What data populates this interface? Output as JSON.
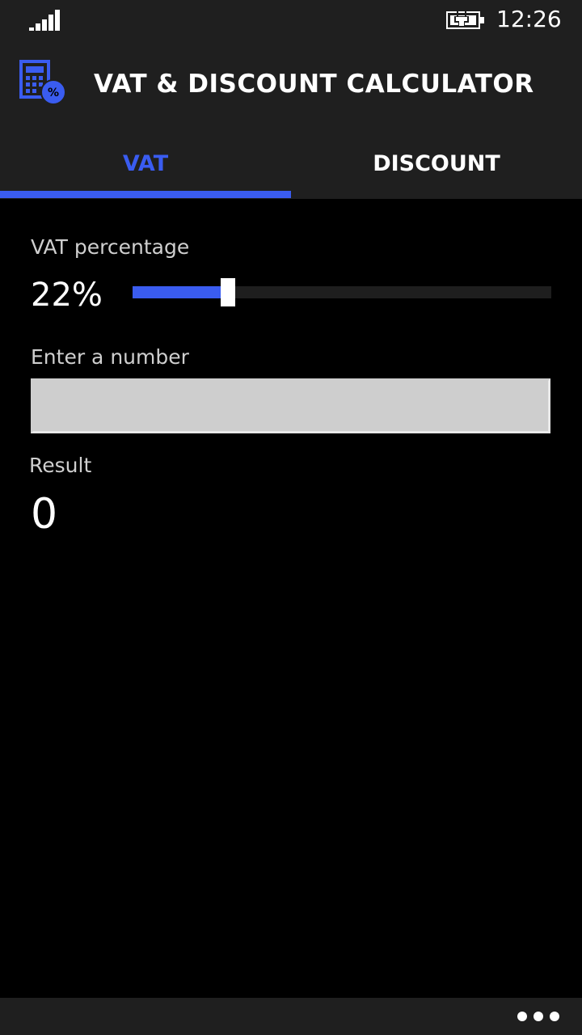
{
  "status_bar": {
    "time": "12:26",
    "signal_icon": "signal-strength-icon",
    "battery_icon": "battery-charging-icon"
  },
  "header": {
    "title": "VAT & DISCOUNT CALCULATOR",
    "app_icon": "calculator-percent-icon"
  },
  "tabs": [
    {
      "label": "VAT",
      "active": true
    },
    {
      "label": "DISCOUNT",
      "active": false
    }
  ],
  "vat": {
    "label": "VAT percentage",
    "value_text": "22%",
    "slider_value": 22,
    "slider_fill_fraction": 0.22
  },
  "input": {
    "label": "Enter a number",
    "value": "",
    "placeholder": ""
  },
  "result": {
    "label": "Result",
    "value": "0"
  },
  "app_bar": {
    "more_icon": "more-ellipsis-icon"
  },
  "colors": {
    "accent": "#3a5cf0",
    "chrome": "#1f1f1f",
    "background": "#000000"
  }
}
